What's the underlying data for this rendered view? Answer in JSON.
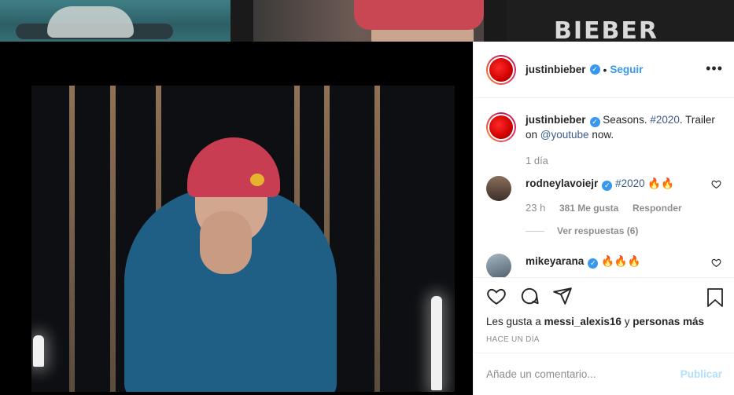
{
  "background": {
    "thumb3_text": "BIEBER"
  },
  "post": {
    "username": "justinbieber",
    "separator": "•",
    "follow_label": "Seguir",
    "more_label": "•••"
  },
  "caption": {
    "username": "justinbieber",
    "text_before": "Seasons.",
    "hashtag": "#2020",
    "text_middle": ". Trailer on",
    "mention": "@youtube",
    "text_after": "now.",
    "age": "1 día"
  },
  "comments": [
    {
      "username": "rodneylavoiejr",
      "hashtag": "#2020",
      "emoji": "🔥🔥",
      "age": "23 h",
      "likes": "381 Me gusta",
      "reply_label": "Responder",
      "view_replies": "Ver respuestas (6)"
    },
    {
      "username": "mikeyarana",
      "emoji": "🔥🔥🔥"
    }
  ],
  "likes": {
    "prefix": "Les gusta a",
    "user": "messi_alexis16",
    "connector": "y",
    "rest": "personas más"
  },
  "timestamp": "HACE UN DÍA",
  "compose": {
    "placeholder": "Añade un comentario...",
    "publish_label": "Publicar"
  },
  "colors": {
    "accent": "#3897f0",
    "publish_disabled": "#b2dffc"
  },
  "icons": [
    "heart-icon",
    "comment-icon",
    "share-icon",
    "bookmark-icon",
    "verified-icon",
    "more-icon"
  ]
}
